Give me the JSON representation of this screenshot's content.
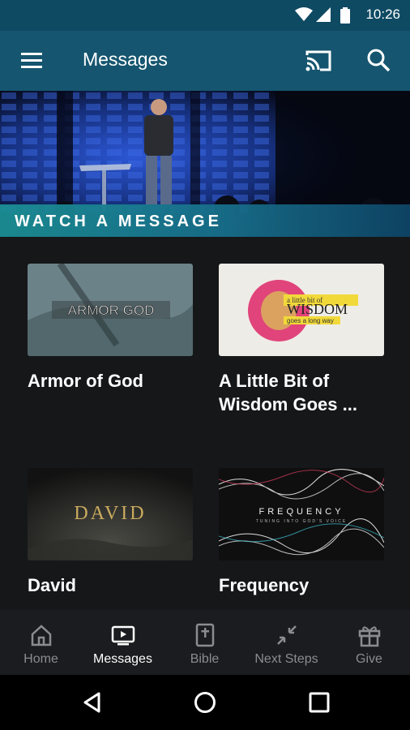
{
  "status_bar": {
    "time": "10:26",
    "icons": [
      "wifi-icon",
      "signal-icon",
      "battery-icon"
    ]
  },
  "app_bar": {
    "title": "Messages",
    "menu_icon": "menu-icon",
    "cast_icon": "cast-icon",
    "search_icon": "search-icon"
  },
  "hero": {
    "banner_text": "WATCH A MESSAGE"
  },
  "messages": [
    {
      "title": "Armor of God",
      "thumb_text": "ARMOR GOD"
    },
    {
      "title": "A Little Bit of Wisdom Goes ...",
      "thumb_text": "WISDOM",
      "thumb_small": "a little bit of",
      "thumb_sub": "goes a long way"
    },
    {
      "title": "David",
      "thumb_text": "DAVID"
    },
    {
      "title": "Frequency",
      "thumb_text": "FREQUENCY",
      "thumb_sub": "TUNING INTO GOD'S VOICE"
    }
  ],
  "tabs": [
    {
      "label": "Home",
      "icon": "home-icon",
      "active": false
    },
    {
      "label": "Messages",
      "icon": "tv-play-icon",
      "active": true
    },
    {
      "label": "Bible",
      "icon": "bible-icon",
      "active": false
    },
    {
      "label": "Next Steps",
      "icon": "arrows-in-icon",
      "active": false
    },
    {
      "label": "Give",
      "icon": "gift-icon",
      "active": false
    }
  ],
  "colors": {
    "app_bar": "#15556f",
    "status_bar": "#0f4a63",
    "background": "#161719",
    "banner": "#1b8e94"
  }
}
